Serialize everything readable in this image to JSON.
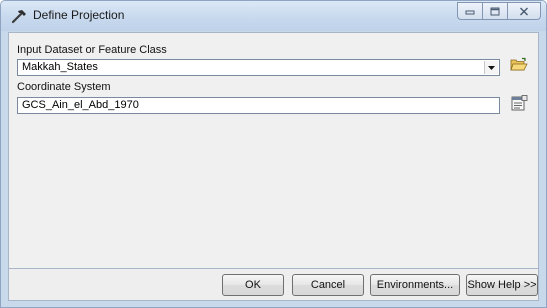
{
  "window": {
    "title": "Define Projection",
    "title_icon": "hammer-icon",
    "controls": {
      "minimize": "minimize-icon",
      "maximize": "maximize-icon",
      "close": "close-icon"
    }
  },
  "form": {
    "input_label": "Input Dataset or Feature Class",
    "input_value": "Makkah_States",
    "browse_icon": "open-folder-icon",
    "coord_label": "Coordinate System",
    "coord_value": "GCS_Ain_el_Abd_1970",
    "properties_icon": "properties-icon"
  },
  "buttons": {
    "ok": "OK",
    "cancel": "Cancel",
    "environments": "Environments...",
    "show_help": "Show Help >>"
  },
  "colors": {
    "frame": "#c9d9ec",
    "client_bg": "#f0f0f0",
    "field_bg": "#ffffff"
  }
}
